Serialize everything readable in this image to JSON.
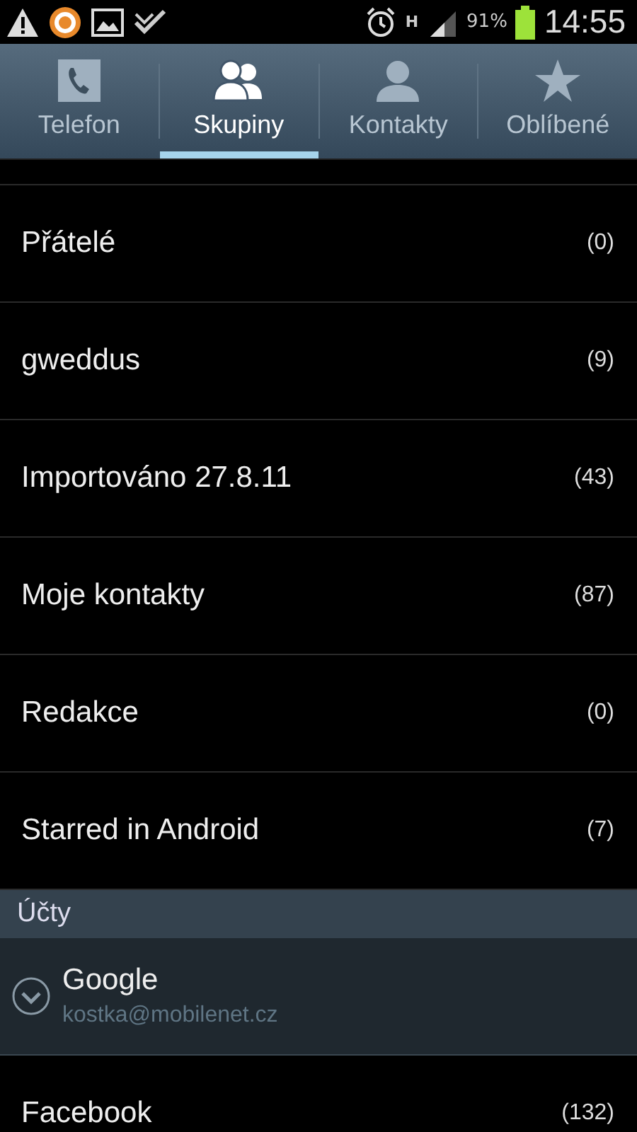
{
  "status_bar": {
    "battery": "91%",
    "time": "14:55",
    "network": "H"
  },
  "tabs": [
    {
      "label": "Telefon",
      "kind": "phone",
      "selected": false
    },
    {
      "label": "Skupiny",
      "kind": "group",
      "selected": true
    },
    {
      "label": "Kontakty",
      "kind": "person",
      "selected": false
    },
    {
      "label": "Oblíbené",
      "kind": "star",
      "selected": false
    }
  ],
  "groups": [
    {
      "name": "Přátelé",
      "count": "(0)"
    },
    {
      "name": "gweddus",
      "count": "(9)"
    },
    {
      "name": "Importováno 27.8.11",
      "count": "(43)"
    },
    {
      "name": "Moje kontakty",
      "count": "(87)"
    },
    {
      "name": "Redakce",
      "count": "(0)"
    },
    {
      "name": "Starred in Android",
      "count": "(7)"
    }
  ],
  "accounts_header": "Účty",
  "accounts": [
    {
      "name": "Google",
      "email": "kostka@mobilenet.cz",
      "expanded": true
    },
    {
      "name": "Facebook",
      "count": "(132)",
      "expanded": false
    }
  ]
}
